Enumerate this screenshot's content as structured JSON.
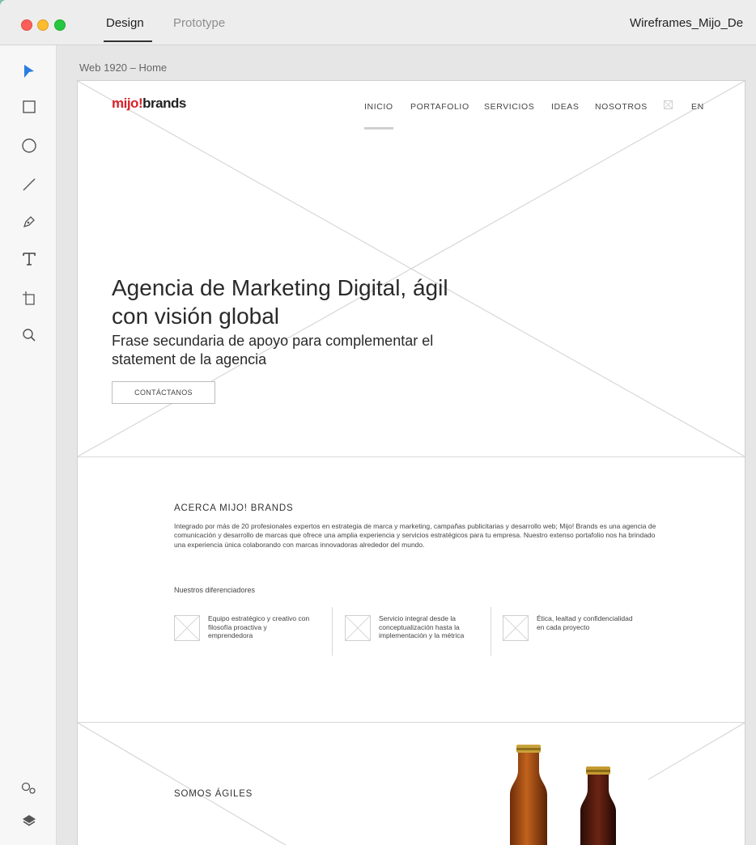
{
  "titlebar": {
    "tabs": [
      "Design",
      "Prototype"
    ],
    "document_title": "Wireframes_Mijo_De"
  },
  "toolbar": {
    "tools": [
      "select-tool",
      "rectangle-tool",
      "ellipse-tool",
      "line-tool",
      "pen-tool",
      "text-tool",
      "artboard-tool",
      "zoom-tool"
    ],
    "bottom_tools": [
      "symbols-icon",
      "layers-icon"
    ]
  },
  "artboard": {
    "label": "Web 1920 – Home"
  },
  "site": {
    "logo": {
      "part1": "mijo!",
      "part2": "brands"
    },
    "nav": [
      "INICIO",
      "PORTAFOLIO",
      "SERVICIOS",
      "IDEAS",
      "NOSOTROS",
      "EN"
    ],
    "hero": {
      "title": "Agencia de Marketing Digital, ágil con visión global",
      "subtitle": "Frase secundaria de apoyo para complementar el statement de la agencia",
      "cta": "CONTÁCTANOS"
    },
    "about": {
      "title": "ACERCA MIJO! BRANDS",
      "body": "Integrado por más de 20 profesionales expertos en estrategia de marca y marketing, campañas publicitarias y desarrollo web; Mijo! Brands es una agencia de comunicación y desarrollo de marcas que ofrece una amplia experiencia y servicios estratégicos para tu empresa. Nuestro extenso portafolio nos ha brindado una experiencia única colaborando con marcas innovadoras alrededor del mundo.",
      "diff_title": "Nuestros diferenciadores",
      "differentiators": [
        "Equipo estratégico y creativo con filosofía proactiva y emprendedora",
        "Servicio integral desde la conceptualización hasta la implementación y la métrica",
        "Ética, lealtad y confidencialidad en cada proyecto"
      ]
    },
    "section3": {
      "title": "SOMOS ÁGILES"
    }
  },
  "colors": {
    "brand_red": "#d8222a",
    "placeholder_stroke": "#d0d0d0"
  }
}
